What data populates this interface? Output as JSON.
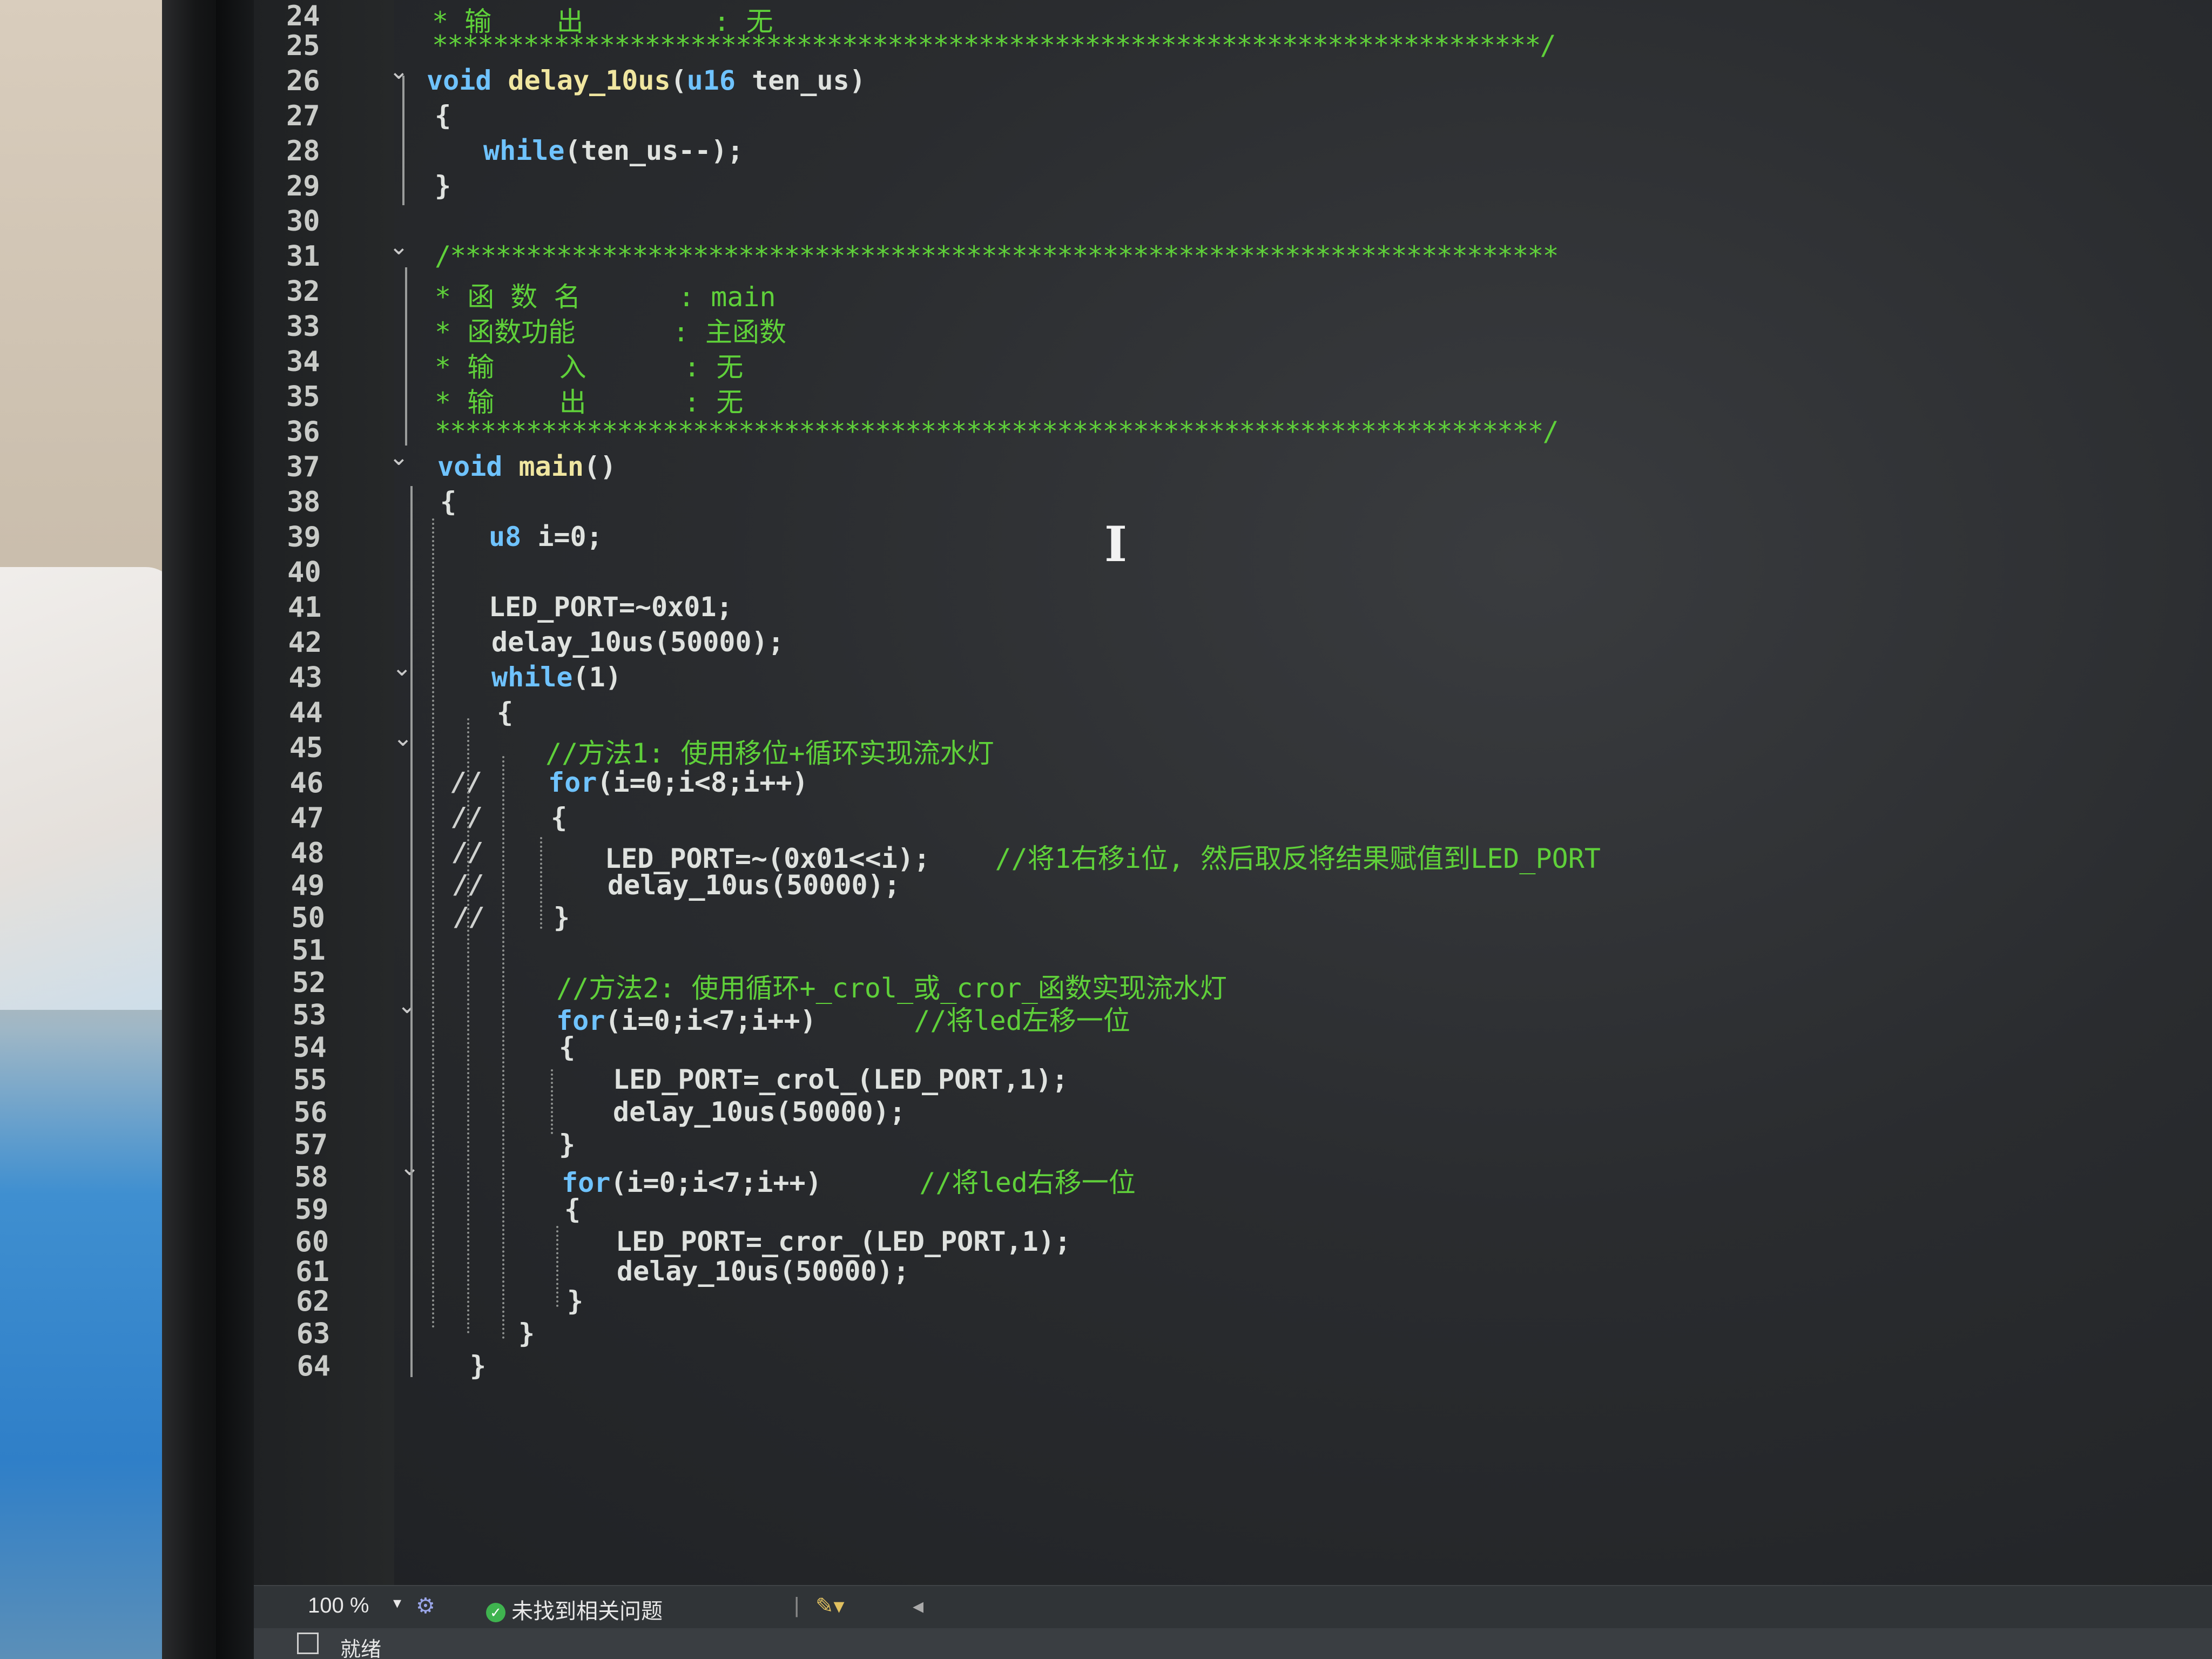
{
  "editor": {
    "zoom": "100 %",
    "issues_status": "未找到相关问题",
    "ready_status": "就绪",
    "colors": {
      "background": "#2a2c2f",
      "keyword": "#6fc3ff",
      "comment": "#5fd03a",
      "text": "#dfe2df"
    },
    "lines": [
      {
        "n": "24",
        "text": "* 输    出        : 无",
        "type": "comment"
      },
      {
        "n": "25",
        "text": "*************************************************************************/",
        "type": "comment"
      },
      {
        "n": "26",
        "kw": "void",
        "fn": "delay_10us",
        "rest": "(",
        "kw2": "u16",
        "rest2": " ten_us)",
        "type": "sig",
        "fold": true
      },
      {
        "n": "27",
        "text": "{",
        "type": "code"
      },
      {
        "n": "28",
        "kw": "while",
        "rest": "(ten_us--);",
        "type": "kwline"
      },
      {
        "n": "29",
        "text": "}",
        "type": "code"
      },
      {
        "n": "30",
        "text": "",
        "type": "code"
      },
      {
        "n": "31",
        "text": "/*************************************************************************",
        "type": "comment",
        "fold": true
      },
      {
        "n": "32",
        "text": "* 函 数 名      : main",
        "type": "comment"
      },
      {
        "n": "33",
        "text": "* 函数功能      : 主函数",
        "type": "comment"
      },
      {
        "n": "34",
        "text": "* 输    入      : 无",
        "type": "comment"
      },
      {
        "n": "35",
        "text": "* 输    出      : 无",
        "type": "comment"
      },
      {
        "n": "36",
        "text": "*************************************************************************/",
        "type": "comment"
      },
      {
        "n": "37",
        "kw": "void",
        "fn": "main",
        "rest": "()",
        "type": "sig2",
        "fold": true
      },
      {
        "n": "38",
        "text": "{",
        "type": "code"
      },
      {
        "n": "39",
        "kw": "u8",
        "rest": " i=0;",
        "type": "kwline"
      },
      {
        "n": "40",
        "text": "",
        "type": "code"
      },
      {
        "n": "41",
        "text": "LED_PORT=~0x01;",
        "type": "code"
      },
      {
        "n": "42",
        "text": "delay_10us(50000);",
        "type": "code"
      },
      {
        "n": "43",
        "kw": "while",
        "rest": "(1)",
        "type": "kwline",
        "fold": true
      },
      {
        "n": "44",
        "text": "{",
        "type": "code"
      },
      {
        "n": "45",
        "text": "//方法1: 使用移位+循环实现流水灯",
        "type": "comment",
        "fold": true
      },
      {
        "n": "46",
        "kw": "for",
        "rest": "(i=0;i<8;i++)",
        "type": "kwline",
        "cm": "//"
      },
      {
        "n": "47",
        "text": "{",
        "type": "code",
        "cm": "//"
      },
      {
        "n": "48",
        "text": "LED_PORT=~(0x01<<i);",
        "cmt": "//将1右移i位, 然后取反将结果赋值到LED_PORT",
        "type": "codecmt",
        "cm": "//"
      },
      {
        "n": "49",
        "text": "delay_10us(50000);",
        "type": "code",
        "cm": "//"
      },
      {
        "n": "50",
        "text": "}",
        "type": "code",
        "cm": "//"
      },
      {
        "n": "51",
        "text": "",
        "type": "code"
      },
      {
        "n": "52",
        "text": "//方法2: 使用循环+_crol_或_cror_函数实现流水灯",
        "type": "comment"
      },
      {
        "n": "53",
        "kw": "for",
        "rest": "(i=0;i<7;i++)",
        "cmt": "//将led左移一位",
        "type": "kwlinecmt",
        "fold": true
      },
      {
        "n": "54",
        "text": "{",
        "type": "code"
      },
      {
        "n": "55",
        "text": "LED_PORT=_crol_(LED_PORT,1);",
        "type": "code"
      },
      {
        "n": "56",
        "text": "delay_10us(50000);",
        "type": "code"
      },
      {
        "n": "57",
        "text": "}",
        "type": "code"
      },
      {
        "n": "58",
        "kw": "for",
        "rest": "(i=0;i<7;i++)",
        "cmt": "//将led右移一位",
        "type": "kwlinecmt",
        "fold": true
      },
      {
        "n": "59",
        "text": "{",
        "type": "code"
      },
      {
        "n": "60",
        "text": "LED_PORT=_cror_(LED_PORT,1);",
        "type": "code"
      },
      {
        "n": "61",
        "text": "delay_10us(50000);",
        "type": "code"
      },
      {
        "n": "62",
        "text": "}",
        "type": "code"
      },
      {
        "n": "63",
        "text": "}",
        "type": "code"
      },
      {
        "n": "64",
        "text": "}",
        "type": "code"
      }
    ]
  }
}
